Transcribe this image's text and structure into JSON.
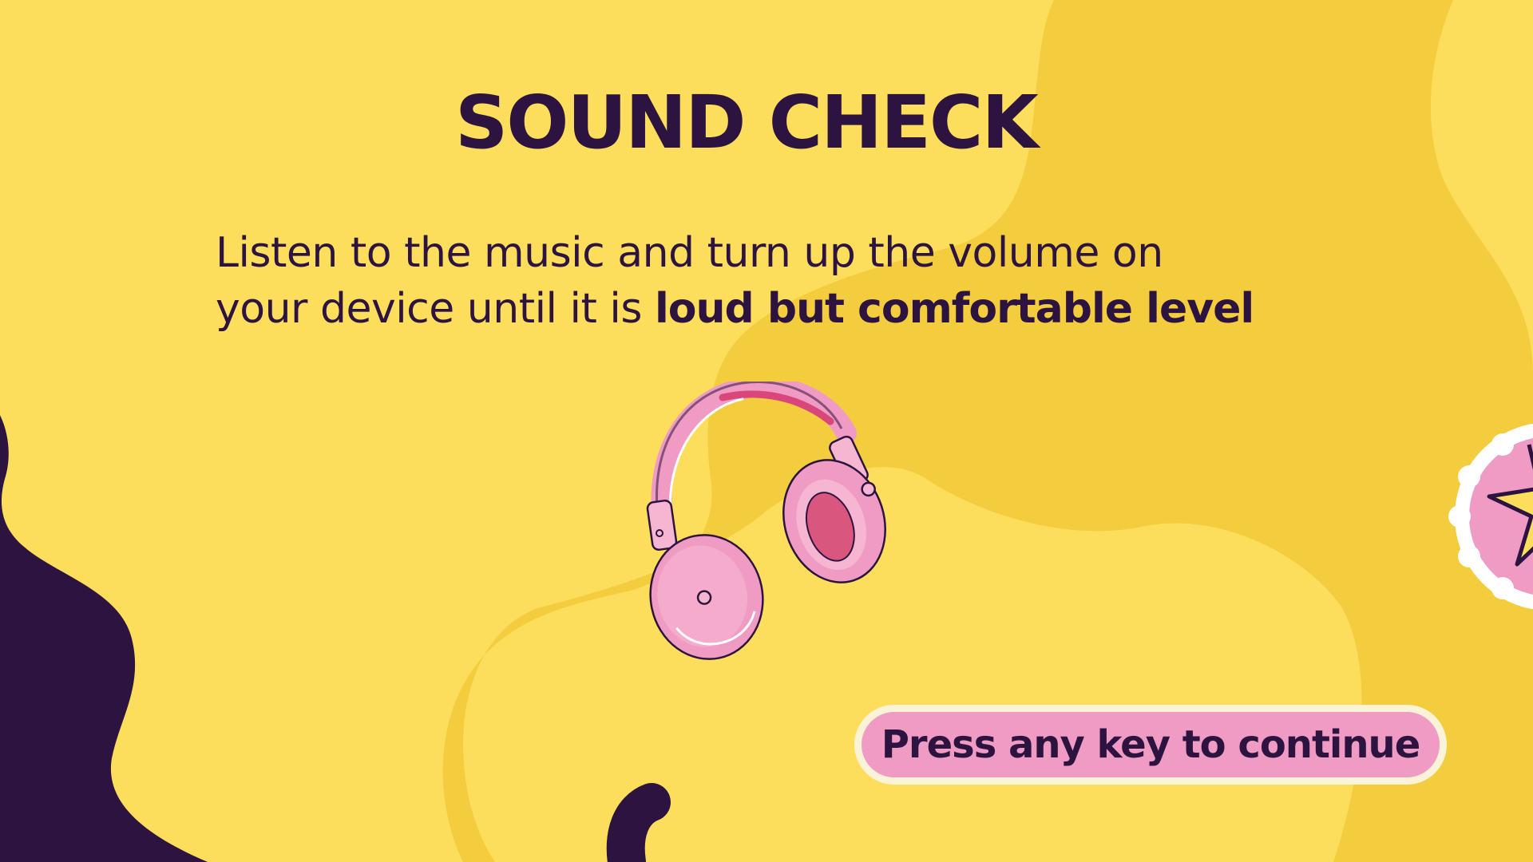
{
  "screen": {
    "title": "SOUND CHECK",
    "instructions": {
      "line1": "Listen to the music and turn up the volume on",
      "line2_plain": "your device until it is ",
      "line2_bold": "loud but comfortable level"
    },
    "continue_button_label": "Press any key to continue"
  },
  "illustrations": {
    "headphones": "headphones-icon",
    "badge": "star-badge-icon"
  },
  "colors": {
    "background_light": "#fddd5c",
    "background_blob": "#f3cd3d",
    "dark_purple": "#2d1440",
    "pink": "#ef9bc3",
    "button_border": "#fbf3d8"
  }
}
